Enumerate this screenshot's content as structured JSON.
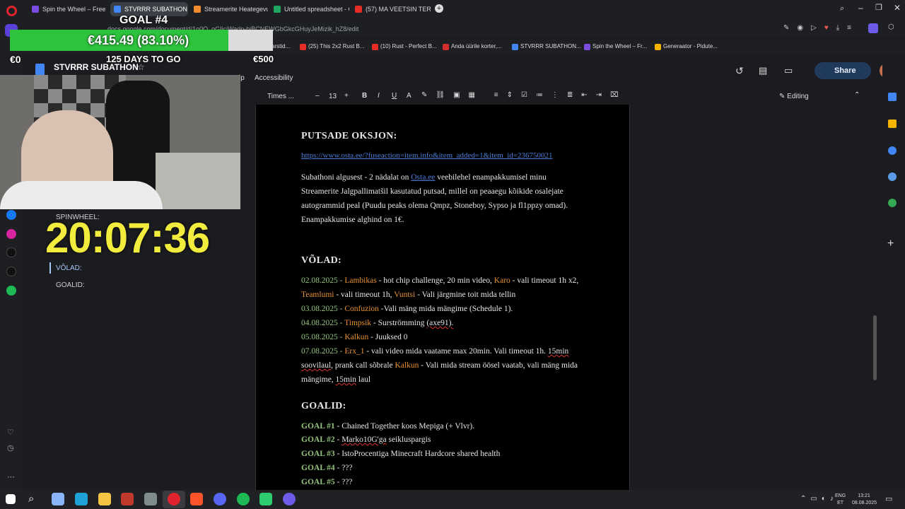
{
  "browser": {
    "tabs": [
      {
        "label": "Spin the Wheel – Free and",
        "color": "#7b4ce0",
        "active": false
      },
      {
        "label": "STVRRR SUBATHON - Go",
        "color": "#4285f4",
        "active": true
      },
      {
        "label": "Streamerite Heategevusm",
        "color": "#f28b30",
        "active": false
      },
      {
        "label": "Untitled spreadsheet - Go",
        "color": "#1fa463",
        "active": false
      },
      {
        "label": "(57) MA VEETSIN TERVE Ö",
        "color": "#e52d27",
        "active": false
      }
    ],
    "new_tab": "+",
    "url": "docs.google.com/document/d/1o0O_oGIjcjWadp-bjBCNEWGbGkcGHuyJeMizik_hZ8/edit",
    "bookmarks": [
      {
        "label": "arstid...",
        "color": "#888"
      },
      {
        "label": "(25) This 2x2 Rust B...",
        "color": "#e52d27"
      },
      {
        "label": "(10) Rust - Perfect B...",
        "color": "#e52d27"
      },
      {
        "label": "Anda üürile korter,...",
        "color": "#d32f2f"
      },
      {
        "label": "STVRRR SUBATHON...",
        "color": "#4285f4"
      },
      {
        "label": "Spin the Wheel – Fr...",
        "color": "#7b4ce0"
      },
      {
        "label": "Generaator - Pidute...",
        "color": "#f4b400"
      }
    ]
  },
  "docs": {
    "title": "STVRRR SUBATHON",
    "menu_partial": "lp",
    "menu_accessibility": "Accessibility",
    "share": "Share",
    "font": "Times ...",
    "font_size": "13",
    "mode": "Editing"
  },
  "document": {
    "auction_heading": "PUTSADE OKSJON:",
    "auction_link": "https://www.osta.ee/?fuseaction=item.info&item_added=1&item_id=236750021",
    "auction_text_1a": "Subathoni algusest - 2 nädalat on ",
    "auction_text_1link": "Osta.ee",
    "auction_text_1b": " veebilehel enampakkumisel minu",
    "auction_text_2": "Streamerite Jalgpallimatšil kasutatud putsad, millel on peaaegu kõikide osalejate",
    "auction_text_3": "autogrammid peal (Puudu peaks olema Qmpz, Stoneboy, Sypso ja fl1ppzy omad).",
    "auction_text_4": "Enampakkumise alghind on 1€.",
    "debts_heading": "VÕLAD:",
    "debts": [
      {
        "date": "02.08.2025",
        "sep1": " - ",
        "name": "Lambikas",
        "text": "  - hot chip challenge, 20 min video, ",
        "name2": "Karo",
        "text2": " - vali timeout 1h x2,"
      },
      {
        "date": "",
        "sep1": "",
        "name": "Teamlumi",
        "text": " - vali timeout 1h, ",
        "name2": "Vuntsi",
        "text2": " - Vali järgmine toit mida tellin"
      },
      {
        "date": "03.08.2025",
        "sep1": " - ",
        "name": "Confuzion",
        "text": " -Vali mäng mida mängime (Schedule 1).",
        "name2": "",
        "text2": ""
      },
      {
        "date": "04.08.2025",
        "sep1": " - ",
        "name": "Timpsik",
        "text": " - Surströmming ",
        "name2": "",
        "text2": "(axe91)."
      },
      {
        "date": "05.08.2025",
        "sep1": " - ",
        "name": "Kalkun",
        "text": " - Juuksed 0",
        "name2": "",
        "text2": ""
      },
      {
        "date": "07.08.2025",
        "sep1": " - ",
        "name": "Erx_1",
        "text": " - vali video mida vaatame max 20min. Vali timeout 1h. ",
        "name2": "",
        "text2": "15min"
      },
      {
        "date": "",
        "sep1": "",
        "name": "",
        "text": "soovilaul",
        "name2": "",
        "text2": ", prank call sõbrale "
      },
      {
        "date": "",
        "sep1": "",
        "name": "",
        "text": "mängime, ",
        "name2": "",
        "text2": "15min"
      }
    ],
    "debt6_kalkun": "Kalkun",
    "debt6_rest": " - Vali mida stream öösel vaatab, vali mäng mida",
    "debt7_rest": " laul",
    "goals_heading": "GOALID:",
    "goals": [
      {
        "label": "GOAL #1",
        "text": " - Chained Together koos Mepiga (+ Vlvr)."
      },
      {
        "label": "GOAL #2",
        "text": " - ",
        "u": "Marko10G'ga",
        "text2": " seikluspargis"
      },
      {
        "label": "GOAL #3",
        "text": " - IstoProcentiga Minecraft Hardcore shared health"
      },
      {
        "label": "GOAL #4",
        "text": " - ???"
      },
      {
        "label": "GOAL #5",
        "text": " - ???"
      }
    ]
  },
  "overlay": {
    "goal_title": "GOAL #4",
    "goal_amount": "€415.49 (83.10%)",
    "goal_progress": 0.831,
    "min": "€0",
    "max": "€500",
    "days": "125 DAYS TO GO",
    "timer": "20:07:36",
    "side_labels": [
      "SPINWHEEL:",
      "VÕLAD:",
      "GOALID:"
    ]
  },
  "taskbar": {
    "lang": "ENG",
    "region": "ET",
    "time": "13:21",
    "date": "08.08.2025"
  }
}
